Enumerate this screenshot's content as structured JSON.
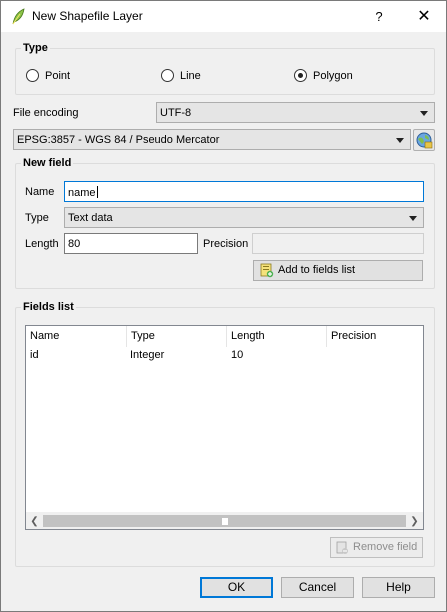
{
  "window": {
    "title": "New Shapefile Layer",
    "help": "?",
    "close": "✕"
  },
  "type_group": {
    "title": "Type",
    "options": [
      {
        "label": "Point",
        "checked": false
      },
      {
        "label": "Line",
        "checked": false
      },
      {
        "label": "Polygon",
        "checked": true
      }
    ]
  },
  "file_encoding": {
    "label": "File encoding",
    "value": "UTF-8"
  },
  "crs": {
    "value": "EPSG:3857 - WGS 84 / Pseudo Mercator"
  },
  "new_field": {
    "title": "New field",
    "name_label": "Name",
    "name_value": "name",
    "type_label": "Type",
    "type_value": "Text data",
    "length_label": "Length",
    "length_value": "80",
    "precision_label": "Precision",
    "precision_value": "",
    "add_button": "Add to fields list"
  },
  "fields_list": {
    "title": "Fields list",
    "columns": [
      "Name",
      "Type",
      "Length",
      "Precision"
    ],
    "rows": [
      [
        "id",
        "Integer",
        "10",
        ""
      ]
    ],
    "remove_button": "Remove field"
  },
  "dialog_buttons": {
    "ok": "OK",
    "cancel": "Cancel",
    "help": "Help"
  }
}
